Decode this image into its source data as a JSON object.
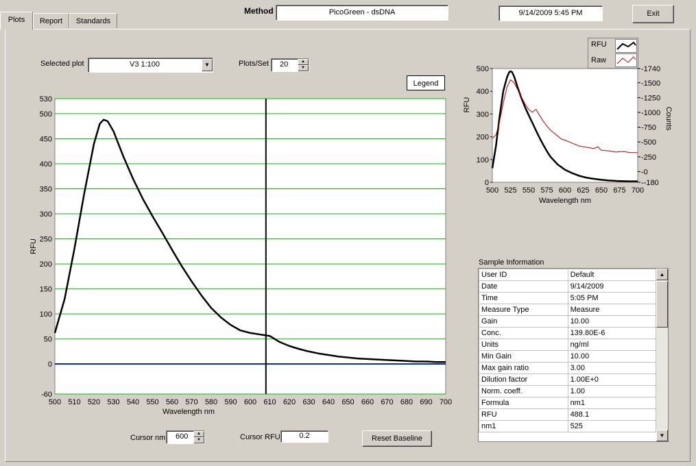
{
  "tabs": [
    {
      "label": "Plots",
      "active": true
    },
    {
      "label": "Report",
      "active": false
    },
    {
      "label": "Standards",
      "active": false
    }
  ],
  "header": {
    "method_label": "Method",
    "method_value": "PicoGreen - dsDNA",
    "datetime": "9/14/2009  5:45 PM",
    "exit_label": "Exit"
  },
  "controls": {
    "selected_plot_label": "Selected plot",
    "selected_plot_value": "V3 1:100",
    "plots_per_set_label": "Plots/Set",
    "plots_per_set_value": "20",
    "legend_button": "Legend",
    "cursor_nm_label": "Cursor nm",
    "cursor_nm_value": "600",
    "cursor_rfu_label": "Cursor RFU",
    "cursor_rfu_value": "0.2",
    "reset_baseline_label": "Reset Baseline"
  },
  "legend": {
    "items": [
      {
        "label": "RFU",
        "color": "#000000"
      },
      {
        "label": "Raw",
        "color": "#c00000"
      }
    ]
  },
  "sample_info": {
    "title": "Sample Information",
    "rows": [
      {
        "key": "User ID",
        "value": "Default"
      },
      {
        "key": "Date",
        "value": "9/14/2009"
      },
      {
        "key": "Time",
        "value": "5:05 PM"
      },
      {
        "key": "Measure Type",
        "value": "Measure"
      },
      {
        "key": "Gain",
        "value": "10.00"
      },
      {
        "key": "Conc.",
        "value": "139.80E-6"
      },
      {
        "key": "Units",
        "value": "ng/ml"
      },
      {
        "key": "Min Gain",
        "value": "10.00"
      },
      {
        "key": "Max gain ratio",
        "value": "3.00"
      },
      {
        "key": "Dilution factor",
        "value": "1.00E+0"
      },
      {
        "key": "Norm. coeff.",
        "value": "1.00"
      },
      {
        "key": "Formula",
        "value": "nm1"
      },
      {
        "key": "RFU",
        "value": "488.1"
      },
      {
        "key": "nm1",
        "value": "525"
      }
    ]
  },
  "chart_data": [
    {
      "type": "line",
      "xlabel": "Wavelength nm",
      "ylabel": "RFU",
      "xlim": [
        500,
        700
      ],
      "ylim": [
        -60,
        530
      ],
      "xticks": [
        500,
        510,
        520,
        530,
        540,
        550,
        560,
        570,
        580,
        590,
        600,
        610,
        620,
        630,
        640,
        650,
        660,
        670,
        680,
        690,
        700
      ],
      "yticks": [
        -60,
        0,
        50,
        100,
        150,
        200,
        250,
        300,
        350,
        400,
        450,
        500,
        530
      ],
      "grid": true,
      "grid_color": "#00c000",
      "cursor_x": 608,
      "baseline_y": 0,
      "series": [
        {
          "color": "#000000",
          "x": [
            500,
            505,
            510,
            515,
            520,
            523,
            525,
            527,
            530,
            535,
            540,
            545,
            550,
            555,
            560,
            565,
            570,
            575,
            580,
            585,
            590,
            595,
            600,
            605,
            610,
            615,
            620,
            625,
            630,
            635,
            640,
            645,
            650,
            655,
            660,
            665,
            670,
            675,
            680,
            685,
            690,
            695,
            700
          ],
          "y": [
            62,
            130,
            230,
            340,
            440,
            480,
            488,
            485,
            465,
            415,
            370,
            330,
            295,
            262,
            228,
            195,
            165,
            137,
            112,
            93,
            78,
            67,
            62,
            59,
            56,
            44,
            36,
            30,
            25,
            21,
            18,
            15,
            13,
            11,
            10,
            9,
            8,
            7,
            6,
            5,
            5,
            4,
            4
          ]
        }
      ]
    },
    {
      "type": "line",
      "xlabel": "Wavelength  nm",
      "ylabel": "RFU",
      "y2label": "Counts",
      "xlim": [
        500,
        700
      ],
      "ylim": [
        0,
        500
      ],
      "y2lim": [
        -180,
        1740
      ],
      "xticks": [
        500,
        525,
        550,
        575,
        600,
        625,
        650,
        675,
        700
      ],
      "yticks": [
        0,
        100,
        200,
        300,
        400,
        500
      ],
      "y2ticks": [
        -180,
        0,
        250,
        500,
        750,
        1000,
        1250,
        1500,
        1740
      ],
      "grid": false,
      "series": [
        {
          "name": "RFU",
          "color": "#000000",
          "axis": "left",
          "x": [
            500,
            505,
            510,
            515,
            520,
            523,
            525,
            527,
            530,
            535,
            540,
            545,
            550,
            555,
            560,
            565,
            570,
            575,
            580,
            590,
            600,
            610,
            620,
            630,
            640,
            650,
            660,
            670,
            680,
            690,
            700
          ],
          "y": [
            62,
            160,
            290,
            400,
            460,
            483,
            488,
            485,
            465,
            415,
            370,
            330,
            295,
            262,
            228,
            195,
            165,
            137,
            112,
            78,
            55,
            40,
            28,
            20,
            15,
            11,
            8,
            6,
            5,
            4,
            4
          ]
        },
        {
          "name": "Raw",
          "color": "#c00000",
          "axis": "right",
          "x": [
            500,
            505,
            510,
            515,
            520,
            525,
            530,
            535,
            540,
            545,
            550,
            555,
            560,
            565,
            570,
            575,
            580,
            585,
            590,
            595,
            600,
            610,
            620,
            630,
            640,
            645,
            650,
            660,
            670,
            680,
            690,
            700
          ],
          "y": [
            560,
            620,
            850,
            1150,
            1420,
            1550,
            1500,
            1380,
            1260,
            1140,
            1050,
            1000,
            1050,
            950,
            850,
            770,
            700,
            650,
            600,
            550,
            530,
            480,
            430,
            410,
            390,
            420,
            360,
            350,
            330,
            340,
            320,
            320
          ]
        }
      ]
    }
  ]
}
